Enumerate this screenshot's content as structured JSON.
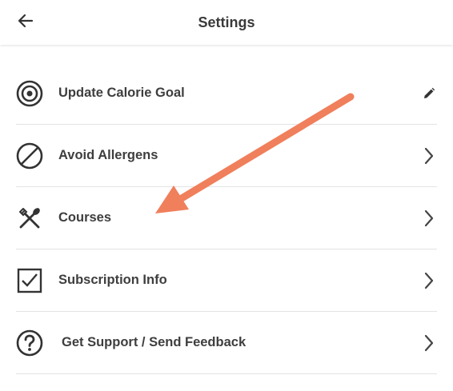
{
  "app_bar": {
    "title": "Settings",
    "back_icon": "arrow-left-icon"
  },
  "settings": {
    "items": [
      {
        "label": "Update Calorie Goal",
        "icon": "target-icon",
        "trailing_icon": "pencil-icon"
      },
      {
        "label": "Avoid Allergens",
        "icon": "prohibited-icon",
        "trailing_icon": "chevron-right-icon"
      },
      {
        "label": "Courses",
        "icon": "utensils-icon",
        "trailing_icon": "chevron-right-icon"
      },
      {
        "label": "Subscription Info",
        "icon": "checkbox-icon",
        "trailing_icon": "chevron-right-icon"
      },
      {
        "label": "Get Support / Send Feedback",
        "icon": "help-icon",
        "trailing_icon": "chevron-right-icon"
      }
    ]
  },
  "annotation": {
    "arrow_color": "#f07f5c"
  },
  "colors": {
    "text": "#3e3e3e",
    "divider": "#e3e3e3",
    "icon": "#333333"
  }
}
